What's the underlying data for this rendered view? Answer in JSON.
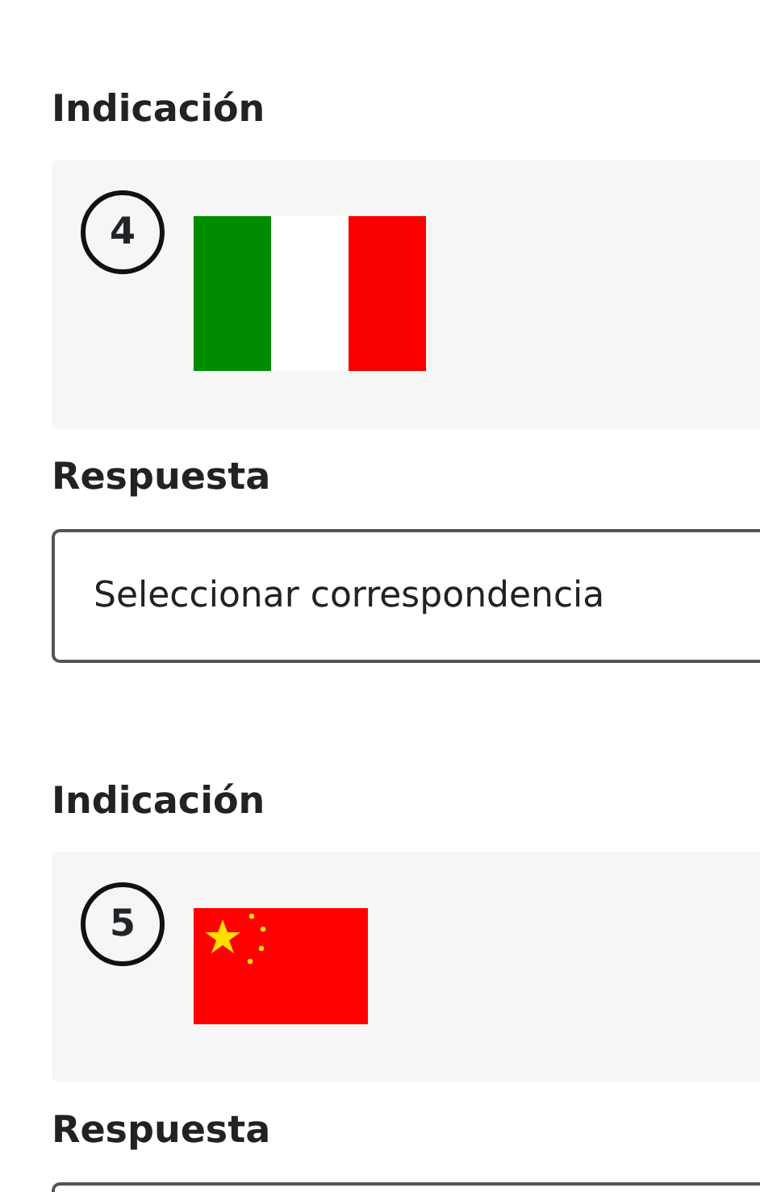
{
  "items": [
    {
      "heading": "Indicación",
      "prompt": {
        "number": "4",
        "kind": "italy"
      },
      "answer_label": "Respuesta",
      "answer": {
        "kind": "select",
        "placeholder": "Seleccionar correspondencia"
      }
    },
    {
      "heading": "Indicación",
      "prompt": {
        "number": "5",
        "kind": "china"
      },
      "answer_label": "Respuesta",
      "answer": {
        "kind": "select"
      }
    }
  ]
}
